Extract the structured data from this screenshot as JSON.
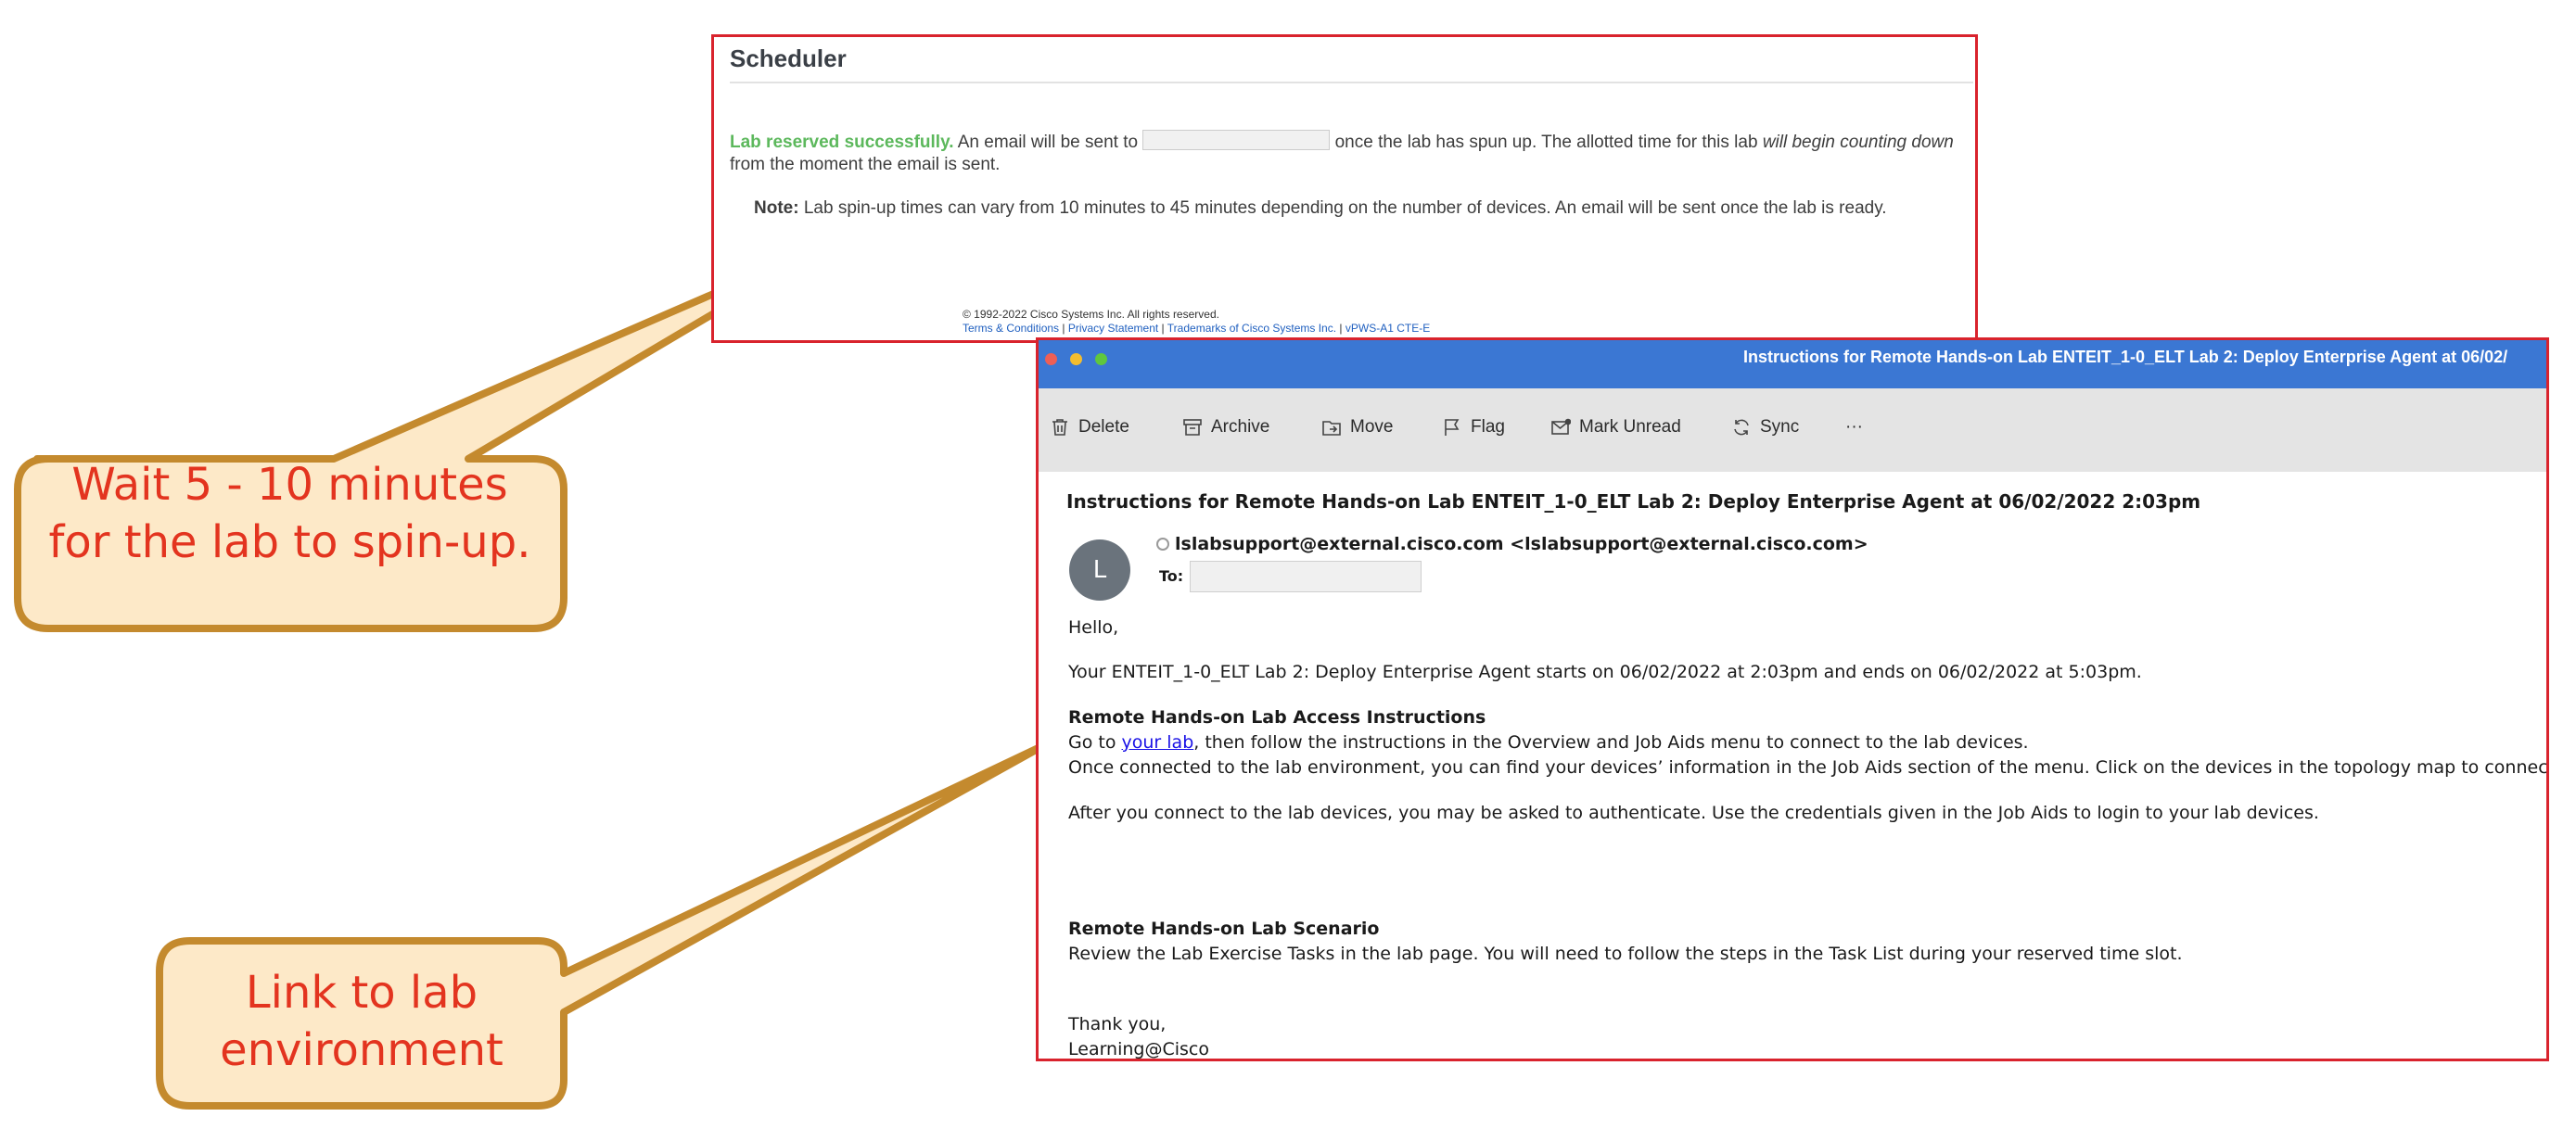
{
  "scheduler": {
    "title": "Scheduler",
    "success_label": "Lab reserved successfully.",
    "msg_part1": " An email will be sent to ",
    "msg_part2": " once the lab has spun up. The allotted time for this lab ",
    "msg_italic": "will begin counting down",
    "msg_part3": " from the moment the email is sent.",
    "note_label": "Note:",
    "note_text": " Lab spin-up times can vary from 10 minutes to 45 minutes depending on the number of devices. An email will be sent once the lab is ready.",
    "copyright": "© 1992-2022 Cisco Systems Inc. All rights reserved.",
    "footer_links": {
      "terms": "Terms & Conditions",
      "privacy": "Privacy Statement",
      "trademarks": "Trademarks of Cisco Systems Inc.",
      "version": "vPWS-A1 CTE-E",
      "sep": " | "
    }
  },
  "mail": {
    "window_title": "Instructions for Remote Hands-on Lab ENTEIT_1-0_ELT Lab 2: Deploy Enterprise Agent at 06/02/",
    "toolbar": {
      "delete": "Delete",
      "archive": "Archive",
      "move": "Move",
      "flag": "Flag",
      "mark_unread": "Mark Unread",
      "sync": "Sync",
      "more": "···"
    },
    "subject": "Instructions for Remote Hands-on Lab ENTEIT_1-0_ELT Lab 2: Deploy Enterprise Agent at 06/02/2022 2:03pm",
    "avatar_letter": "L",
    "from": "lslabsupport@external.cisco.com <lslabsupport@external.cisco.com>",
    "to_label": "To:",
    "greeting": "Hello,",
    "schedule_line": "Your ENTEIT_1-0_ELT Lab 2: Deploy Enterprise Agent starts on 06/02/2022 at 2:03pm and ends on 06/02/2022 at 5:03pm.",
    "access_heading": "Remote Hands-on Lab Access Instructions",
    "goto_prefix": "Go to ",
    "goto_link": "your lab",
    "goto_suffix": ", then follow the instructions in the Overview and Job Aids menu to connect to the lab devices.",
    "connected_line": "Once connected to the lab environment, you can find your devices’ information in the Job Aids section of the menu. Click on the devices in the topology map to connect to them",
    "auth_line": "After you connect to the lab devices, you may be asked to authenticate. Use the credentials given in the Job Aids to login to your lab devices.",
    "scenario_heading": "Remote Hands-on Lab Scenario",
    "scenario_line": "Review the Lab Exercise Tasks in the lab page. You will need to follow the steps in the Task List during your reserved time slot.",
    "thanks": "Thank you,",
    "signature": "Learning@Cisco"
  },
  "callouts": {
    "wait": "Wait 5 - 10 minutes for the lab to spin-up.",
    "link": "Link to lab environment"
  },
  "colors": {
    "frame_red": "#d9232d",
    "title_bar_blue": "#3b77d3",
    "callout_fill": "#fde9c8",
    "callout_border": "#c48a2e",
    "callout_text": "#e3341f",
    "success_green": "#5cb85c"
  }
}
